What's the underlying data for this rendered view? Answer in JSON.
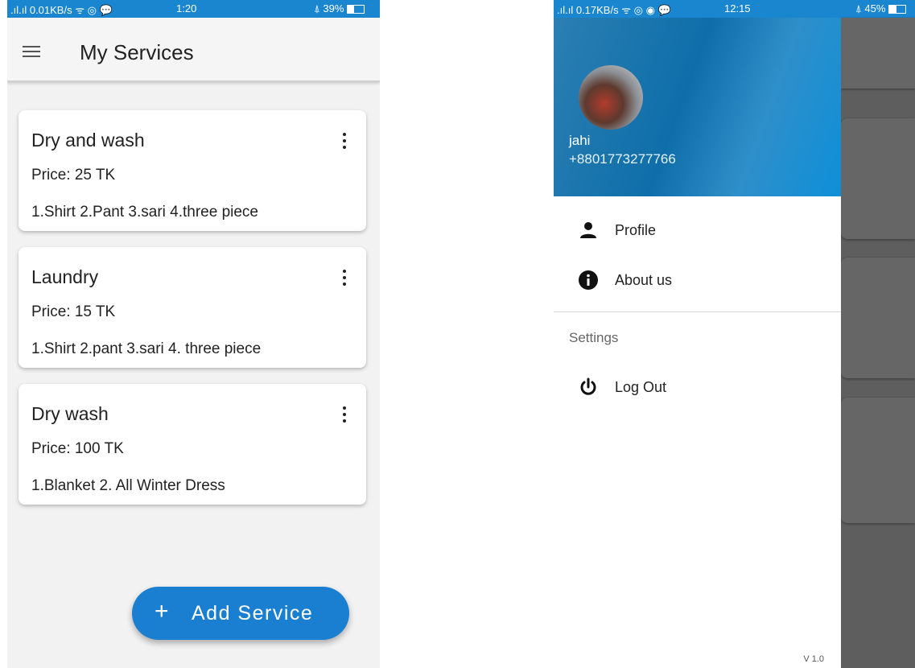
{
  "left": {
    "status": {
      "signal": ".ıl.ıl 0.01KB/s ᯤ ◎ 💬",
      "time": "1:20",
      "battery": "⍋ 39%",
      "battery_level": 0.39
    },
    "appbar": {
      "title": "My Services"
    },
    "services": [
      {
        "name": "Dry and wash",
        "price": "Price:  25 TK",
        "items": "1.Shirt 2.Pant 3.sari 4.three piece"
      },
      {
        "name": "Laundry",
        "price": "Price:  15 TK",
        "items": "1.Shirt 2.pant 3.sari 4. three piece"
      },
      {
        "name": "Dry wash",
        "price": "Price:  100 TK",
        "items": " 1.Blanket 2. All Winter Dress"
      }
    ],
    "fab": {
      "icon": "+",
      "label": "Add Service"
    }
  },
  "right": {
    "status": {
      "signal": ".ıl.ıl 0.17KB/s ᯤ ◎ ◉ 💬",
      "time": "12:15",
      "battery": "⍋ 45%",
      "battery_level": 0.45
    },
    "drawer": {
      "username": "jahi",
      "phone": "+8801773277766",
      "items": [
        {
          "label": "Profile",
          "icon": "person-icon"
        },
        {
          "label": "About us",
          "icon": "info-icon"
        }
      ],
      "section_title": "Settings",
      "settings_items": [
        {
          "label": "Log Out",
          "icon": "power-icon"
        }
      ],
      "version": "V 1.0"
    }
  },
  "colors": {
    "accent": "#1b7fd1",
    "statusbar": "#1a86d0",
    "header": "#1377b5"
  }
}
